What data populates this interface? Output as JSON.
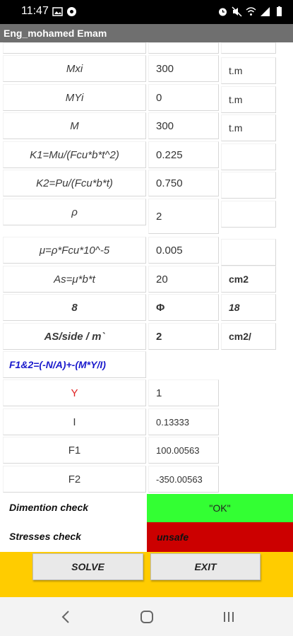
{
  "status_bar": {
    "time": "11:47",
    "left_icons": [
      "gallery-icon",
      "settings-icon"
    ],
    "right_icons": [
      "alarm-icon",
      "mute-icon",
      "wifi-icon",
      "signal-icon",
      "battery-icon"
    ]
  },
  "app": {
    "title": "Eng_mohamed Emam"
  },
  "rows": [
    {
      "label": "Mxi",
      "value": "300",
      "unit": "t.m"
    },
    {
      "label": "MYi",
      "value": "0",
      "unit": "t.m"
    },
    {
      "label": "M",
      "value": "300",
      "unit": "t.m"
    },
    {
      "label": "K1=Mu/(Fcu*b*t^2)",
      "value": "0.225",
      "unit": ""
    },
    {
      "label": "K2=Pu/(Fcu*b*t)",
      "value": "0.750",
      "unit": ""
    },
    {
      "label": "ρ",
      "value": "2",
      "unit": ""
    },
    {
      "label": "μ=ρ*Fcu*10^-5",
      "value": "0.005",
      "unit": ""
    },
    {
      "label": "As=μ*b*t",
      "value": "20",
      "unit": "cm2"
    },
    {
      "label": "8",
      "value": "Φ",
      "unit": "18"
    },
    {
      "label": "AS/side / m`",
      "value": "2",
      "unit": "cm2/"
    }
  ],
  "formula_label": "F1&2=(-N/A)+-(M*Y/I)",
  "stress_rows": [
    {
      "label": "Y",
      "value": "1"
    },
    {
      "label": "I",
      "value": "0.13333"
    },
    {
      "label": "F1",
      "value": "100.00563"
    },
    {
      "label": "F2",
      "value": "-350.00563"
    }
  ],
  "checks": {
    "dimension_label": "Dimention check",
    "dimension_value": "\"OK\"",
    "stresses_label": "Stresses check",
    "stresses_value": "unsafe"
  },
  "buttons": {
    "solve": "SOLVE",
    "exit": "EXIT"
  },
  "colors": {
    "status_bar": "#000000",
    "title_bar": "#6f6f6f",
    "ok": "#33ff33",
    "unsafe": "#cc0000",
    "button_bar": "#ffcc00",
    "formula": "#1a1acc",
    "y_label": "#e02020"
  },
  "navigation": [
    "back-icon",
    "home-icon",
    "recents-icon"
  ]
}
